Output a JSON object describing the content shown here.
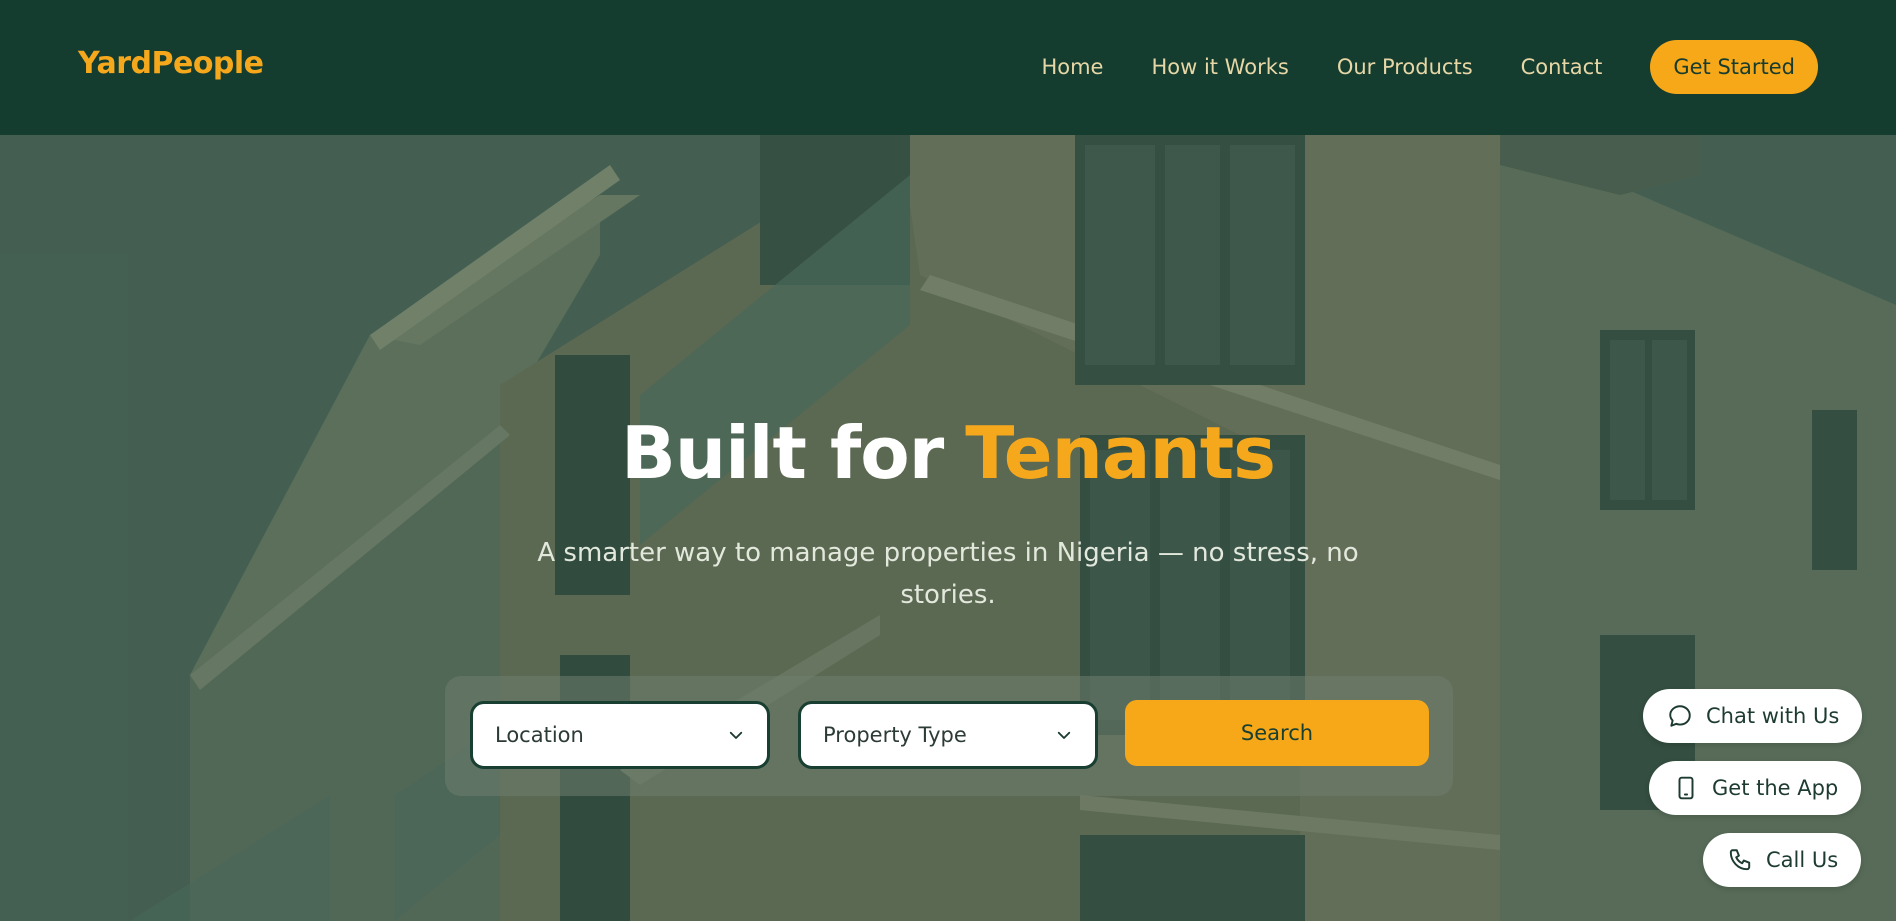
{
  "header": {
    "logo": "YardPeople",
    "nav": [
      {
        "label": "Home"
      },
      {
        "label": "How it Works"
      },
      {
        "label": "Our Products"
      },
      {
        "label": "Contact"
      }
    ],
    "cta_label": "Get Started"
  },
  "hero": {
    "title_main": "Built for",
    "title_accent": "Tenants",
    "subtitle": "A smarter way to manage properties in Nigeria — no stress, no stories.",
    "search": {
      "location_label": "Location",
      "property_type_label": "Property Type",
      "button_label": "Search"
    }
  },
  "floating_actions": {
    "chat_label": "Chat with Us",
    "app_label": "Get the App",
    "call_label": "Call Us"
  },
  "colors": {
    "brand_green": "#153d2f",
    "accent_orange": "#f7a818",
    "nav_text": "#e7d6a6"
  },
  "icons": {
    "dropdown": "chevron-down-icon",
    "chat": "chat-bubble-icon",
    "app": "mobile-phone-icon",
    "call": "phone-icon"
  }
}
